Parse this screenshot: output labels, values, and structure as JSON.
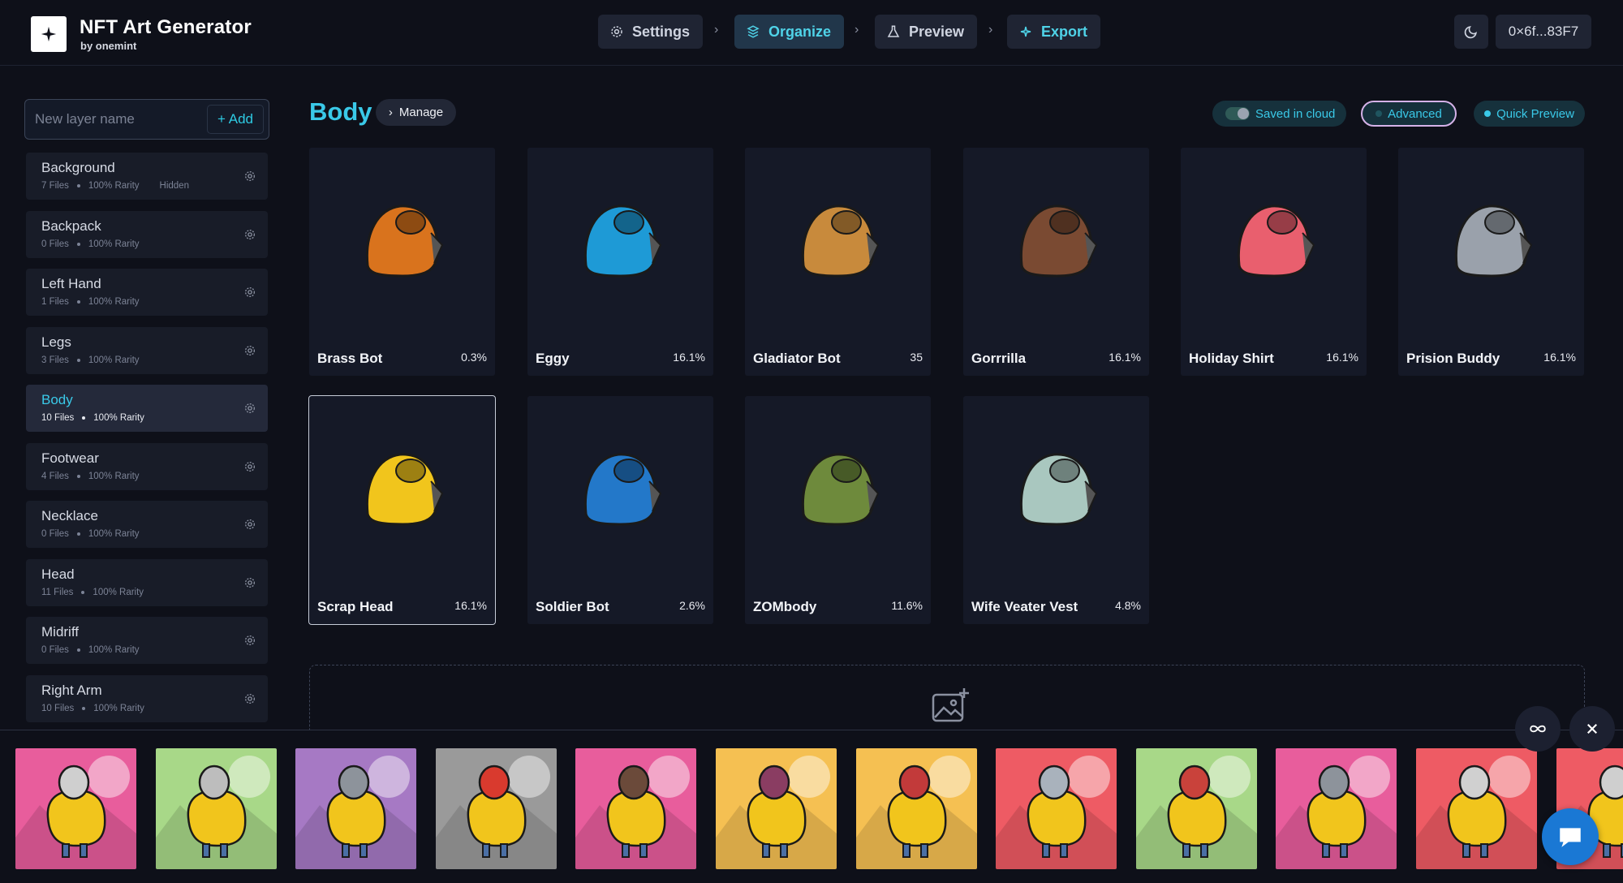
{
  "brand": {
    "title": "NFT Art Generator",
    "subtitle": "by onemint"
  },
  "steps": [
    {
      "label": "Settings",
      "icon": "gear-icon"
    },
    {
      "label": "Organize",
      "icon": "layers-icon"
    },
    {
      "label": "Preview",
      "icon": "flask-icon"
    },
    {
      "label": "Export",
      "icon": "sparkle-icon"
    }
  ],
  "wallet": {
    "address": "0×6f...83F7",
    "theme_icon": "moon-icon"
  },
  "sidebar": {
    "new_layer_placeholder": "New layer name",
    "add_label": "+ Add",
    "layers": [
      {
        "name": "Background",
        "files": "7 Files",
        "rarity": "100% Rarity",
        "extra": "Hidden"
      },
      {
        "name": "Backpack",
        "files": "0 Files",
        "rarity": "100% Rarity",
        "extra": ""
      },
      {
        "name": "Left Hand",
        "files": "1 Files",
        "rarity": "100% Rarity",
        "extra": ""
      },
      {
        "name": "Legs",
        "files": "3 Files",
        "rarity": "100% Rarity",
        "extra": ""
      },
      {
        "name": "Body",
        "files": "10 Files",
        "rarity": "100% Rarity",
        "extra": ""
      },
      {
        "name": "Footwear",
        "files": "4 Files",
        "rarity": "100% Rarity",
        "extra": ""
      },
      {
        "name": "Necklace",
        "files": "0 Files",
        "rarity": "100% Rarity",
        "extra": ""
      },
      {
        "name": "Head",
        "files": "11 Files",
        "rarity": "100% Rarity",
        "extra": ""
      },
      {
        "name": "Midriff",
        "files": "0 Files",
        "rarity": "100% Rarity",
        "extra": ""
      },
      {
        "name": "Right Arm",
        "files": "10 Files",
        "rarity": "100% Rarity",
        "extra": ""
      }
    ]
  },
  "main": {
    "title": "Body",
    "manage_label": "Manage",
    "saved_label": "Saved in cloud",
    "advanced_label": "Advanced",
    "quick_preview_label": "Quick Preview",
    "cards": [
      {
        "name": "Brass Bot",
        "value": "0.3%",
        "color": "#d9731d"
      },
      {
        "name": "Eggy",
        "value": "16.1%",
        "color": "#1e9ad6"
      },
      {
        "name": "Gladiator Bot",
        "value": "35",
        "color": "#c88a3c"
      },
      {
        "name": "Gorrrilla",
        "value": "16.1%",
        "color": "#7a4a32"
      },
      {
        "name": "Holiday Shirt",
        "value": "16.1%",
        "color": "#e95f6e"
      },
      {
        "name": "Prision Buddy",
        "value": "16.1%",
        "color": "#9aa1ab"
      },
      {
        "name": "Scrap Head",
        "value": "16.1%",
        "color": "#f1c51c"
      },
      {
        "name": "Soldier Bot",
        "value": "2.6%",
        "color": "#2378c9"
      },
      {
        "name": "ZOMbody",
        "value": "11.6%",
        "color": "#6e8a3c"
      },
      {
        "name": "Wife Veater Vest",
        "value": "4.8%",
        "color": "#a9c7bf"
      }
    ]
  },
  "previews": [
    {
      "bg": "#e85d9c",
      "head": "#cfcfcf"
    },
    {
      "bg": "#a8d888",
      "head": "#bdbdbd"
    },
    {
      "bg": "#a679c4",
      "head": "#8d939b"
    },
    {
      "bg": "#9a9a9a",
      "head": "#d93a2e"
    },
    {
      "bg": "#e85d9c",
      "head": "#6b4a3a"
    },
    {
      "bg": "#f5c052",
      "head": "#8a3d62"
    },
    {
      "bg": "#f5c052",
      "head": "#c23a3a"
    },
    {
      "bg": "#ee5b64",
      "head": "#a9b2bc"
    },
    {
      "bg": "#a8d888",
      "head": "#c9423b"
    },
    {
      "bg": "#e85d9c",
      "head": "#8d939b"
    },
    {
      "bg": "#ee5b64",
      "head": "#d0d0d0"
    },
    {
      "bg": "#ee5b64",
      "head": "#cfcfcf"
    }
  ],
  "floating": {
    "loop_icon": "infinity-icon",
    "close_icon": "close-icon",
    "chat_icon": "chat-icon"
  }
}
